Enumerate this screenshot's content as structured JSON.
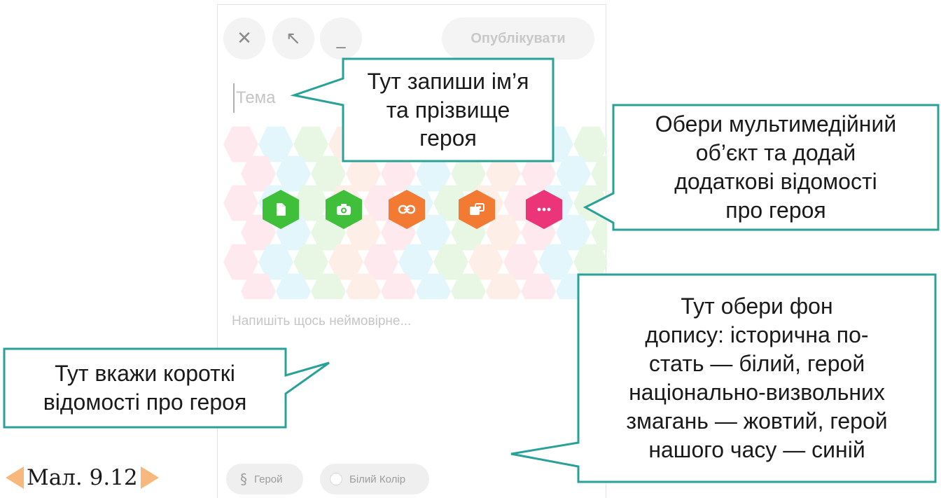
{
  "editor": {
    "close_icon": "close-icon",
    "expand_icon": "expand-arrow-icon",
    "minimize_icon": "minimize-icon",
    "publish_label": "Опублікувати",
    "topic_placeholder": "Тема",
    "body_placeholder": "Напишіть щось неймовірне...",
    "media_buttons": [
      {
        "icon": "file-icon",
        "color": "#3fbf3a"
      },
      {
        "icon": "camera-icon",
        "color": "#3fbf3a"
      },
      {
        "icon": "link-icon",
        "color": "#f27a32"
      },
      {
        "icon": "media-gallery-icon",
        "color": "#f27a32"
      },
      {
        "icon": "more-icon",
        "color": "#ec3478"
      }
    ],
    "topic_chip_label": "Герой",
    "color_chip_label": "Білий Колір"
  },
  "callouts": {
    "name": "Тут запиши ім’я\nта прізвище\nгероя",
    "media": "Обери мультимедійний\nоб’єкт та додай\nдодаткові відомості\nпро героя",
    "background": "Тут обери фон\nдопису: історична по-\nстать — білий, герой\nнаціонально-визвольних\nзмагань — жовтий, герой\nнашого часу — синій",
    "info": "Тут вкажи короткі\nвідомості про героя"
  },
  "figure": {
    "caption": "Мал. 9.12"
  },
  "colors": {
    "callout_border": "#2aa198",
    "caption_arrow": "#f7b77d",
    "green": "#3fbf3a",
    "orange": "#f27a32",
    "pink": "#ec3478"
  }
}
